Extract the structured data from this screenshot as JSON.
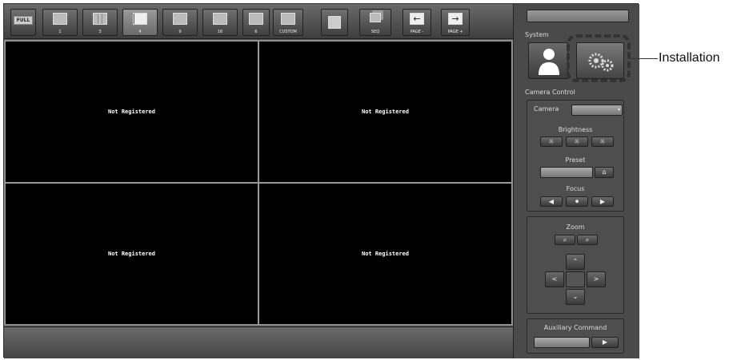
{
  "toolbar": {
    "buttons": [
      {
        "label": "FULL",
        "icon": "full-screen-icon"
      },
      {
        "label": "1",
        "icon": "layout-1-icon"
      },
      {
        "label": "3",
        "icon": "layout-3-icon"
      },
      {
        "label": "4",
        "icon": "layout-4-icon"
      },
      {
        "label": "9",
        "icon": "layout-9-icon"
      },
      {
        "label": "16",
        "icon": "layout-16-icon"
      },
      {
        "label": "6",
        "icon": "layout-6-icon"
      },
      {
        "label": "CUSTOM",
        "icon": "layout-custom-icon"
      },
      {
        "label": "",
        "icon": "camera-info-icon"
      },
      {
        "label": "SEQ",
        "icon": "sequence-icon"
      },
      {
        "label": "PAGE -",
        "icon": "arrow-left-icon"
      },
      {
        "label": "PAGE +",
        "icon": "arrow-right-icon"
      }
    ]
  },
  "video": {
    "tiles": [
      {
        "text": "Not Registered"
      },
      {
        "text": "Not Registered"
      },
      {
        "text": "Not Registered"
      },
      {
        "text": "Not Registered"
      }
    ]
  },
  "side": {
    "system_label": "System",
    "camera_control_label": "Camera Control",
    "camera_label": "Camera",
    "brightness_label": "Brightness",
    "preset_label": "Preset",
    "focus_label": "Focus",
    "zoom_label": "Zoom",
    "aux_label": "Auxiliary Command"
  },
  "annotation": {
    "installation": "Installation"
  },
  "colors": {
    "background": "#555555",
    "video": "#000000",
    "text": "#ffffff"
  }
}
